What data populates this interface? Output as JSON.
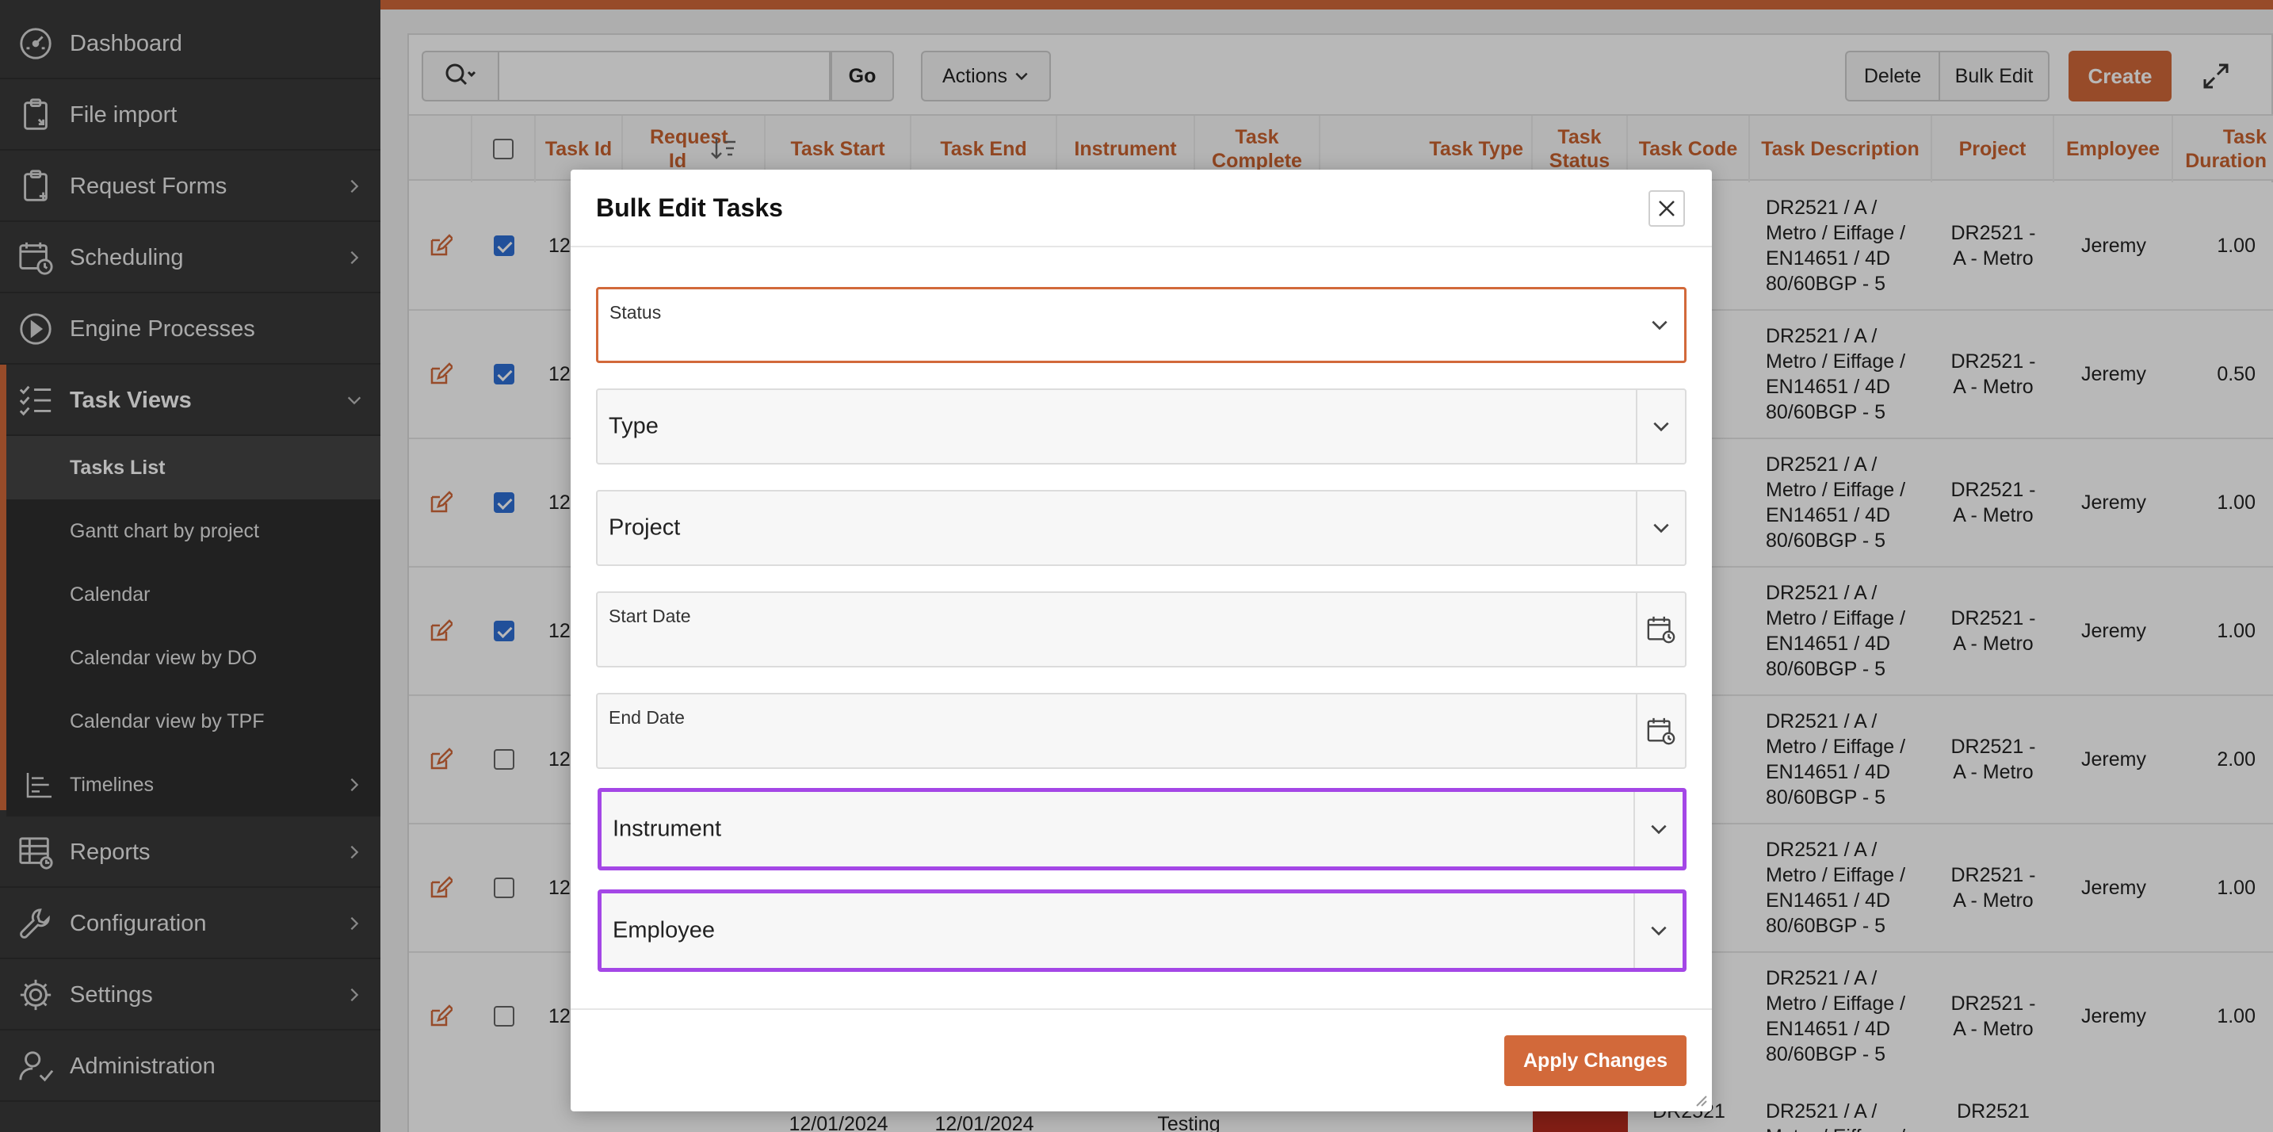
{
  "sidebar": {
    "items": [
      {
        "label": "Dashboard",
        "icon": "gauge-icon"
      },
      {
        "label": "File import",
        "icon": "clipboard-icon"
      },
      {
        "label": "Request Forms",
        "icon": "clipboard-add-icon"
      },
      {
        "label": "Scheduling",
        "icon": "calendar-clock-icon"
      },
      {
        "label": "Engine Processes",
        "icon": "play-circle-icon"
      },
      {
        "label": "Task Views",
        "icon": "checklist-icon"
      },
      {
        "label": "Timelines",
        "icon": "timeline-icon"
      },
      {
        "label": "Reports",
        "icon": "report-table-icon"
      },
      {
        "label": "Configuration",
        "icon": "wrench-icon"
      },
      {
        "label": "Settings",
        "icon": "gear-icon"
      },
      {
        "label": "Administration",
        "icon": "user-admin-icon"
      }
    ],
    "sub_items": [
      {
        "label": "Tasks List"
      },
      {
        "label": "Gantt chart by project"
      },
      {
        "label": "Calendar"
      },
      {
        "label": "Calendar view by DO"
      },
      {
        "label": "Calendar view by TPF"
      }
    ]
  },
  "toolbar": {
    "go_label": "Go",
    "actions_label": "Actions",
    "delete_label": "Delete",
    "bulk_edit_label": "Bulk Edit",
    "create_label": "Create"
  },
  "table": {
    "columns": [
      {
        "label": "Task Id"
      },
      {
        "label": "Request Id"
      },
      {
        "label": "Task Start"
      },
      {
        "label": "Task End"
      },
      {
        "label": "Instrument"
      },
      {
        "label": "Task Complete"
      },
      {
        "label": "Task Type"
      },
      {
        "label": "Task Status"
      },
      {
        "label": "Task Code"
      },
      {
        "label": "Task Description"
      },
      {
        "label": "Project"
      },
      {
        "label": "Employee"
      },
      {
        "label": "Task Duration"
      }
    ],
    "rows": [
      {
        "checked": true,
        "task_id": "12",
        "description": "DR2521 / A / Metro / Eiffage / EN14651 / 4D 80/60BGP - 5",
        "project": "DR2521 - A - Metro",
        "employee": "Jeremy",
        "duration": "1.00"
      },
      {
        "checked": true,
        "task_id": "12",
        "description": "DR2521 / A / Metro / Eiffage / EN14651 / 4D 80/60BGP - 5",
        "project": "DR2521 - A - Metro",
        "employee": "Jeremy",
        "duration": "0.50"
      },
      {
        "checked": true,
        "task_id": "12",
        "description": "DR2521 / A / Metro / Eiffage / EN14651 / 4D 80/60BGP - 5",
        "project": "DR2521 - A - Metro",
        "employee": "Jeremy",
        "duration": "1.00"
      },
      {
        "checked": true,
        "task_id": "12",
        "description": "DR2521 / A / Metro / Eiffage / EN14651 / 4D 80/60BGP - 5",
        "project": "DR2521 - A - Metro",
        "employee": "Jeremy",
        "duration": "1.00"
      },
      {
        "checked": false,
        "task_id": "12",
        "description": "DR2521 / A / Metro / Eiffage / EN14651 / 4D 80/60BGP - 5",
        "project": "DR2521 - A - Metro",
        "employee": "Jeremy",
        "duration": "2.00"
      },
      {
        "checked": false,
        "task_id": "12",
        "description": "DR2521 / A / Metro / Eiffage / EN14651 / 4D 80/60BGP - 5",
        "project": "DR2521 - A - Metro",
        "employee": "Jeremy",
        "duration": "1.00"
      },
      {
        "checked": false,
        "task_id": "12",
        "description": "DR2521 / A / Metro / Eiffage / EN14651 / 4D 80/60BGP - 5",
        "project": "DR2521 - A - Metro",
        "employee": "Jeremy",
        "duration": "1.00"
      }
    ],
    "partial_row": {
      "task_start": "12/01/2024",
      "task_end": "12/01/2024",
      "task_type": "Testing",
      "task_code": "DR2521",
      "description": "DR2521 / A / Metro / Eiffage /",
      "project": "DR2521"
    }
  },
  "dialog": {
    "title": "Bulk Edit Tasks",
    "fields": {
      "status": "Status",
      "type": "Type",
      "project": "Project",
      "start_date": "Start Date",
      "end_date": "End Date",
      "instrument": "Instrument",
      "employee": "Employee"
    },
    "apply_label": "Apply Changes"
  },
  "colors": {
    "accent": "#d2693a",
    "highlight": "#a447e6",
    "checkbox": "#2f6fd6",
    "status_red": "#b52a1e"
  }
}
